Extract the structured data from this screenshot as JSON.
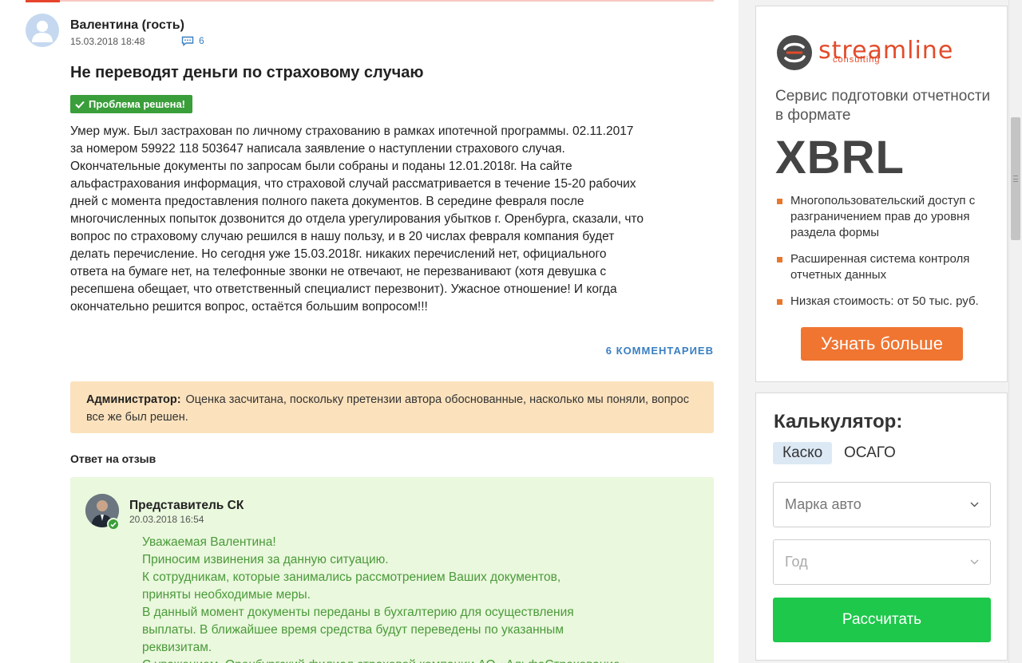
{
  "review": {
    "author": "Валентина (гость)",
    "date": "15.03.2018 18:48",
    "comments_count": "6",
    "title": "Не переводят деньги по страховому случаю",
    "status_badge": "Проблема решена!",
    "body_lines": [
      "Умер муж. Был застрахован по личному страхованию в рамках ипотечной программы. 02.11.2017",
      "за номером 59922 118 503647 написала заявление о наступлении страхового случая.",
      "Окончательные документы по запросам были собраны и поданы 12.01.2018г. На сайте",
      "альфастрахования информация, что страховой случай рассматривается в течение 15-20 рабочих",
      "дней с момента предоставления полного пакета документов. В середине февраля после",
      "многочисленных попыток дозвонится до отдела урегулирования убытков г. Оренбурга, сказали, что",
      "вопрос по страховому случаю решился в нашу пользу, и в 20 числах февраля компания будет",
      "делать перечисление. Но сегодня уже 15.03.2018г. никаких перечислений нет, официального",
      "ответа на бумаге нет, на телефонные звонки не отвечают, не перезванивают (хотя девушка с",
      "ресепшена обещает, что ответственный специалист перезвонит). Ужасное отношение! И когда",
      "окончательно решится вопрос, остаётся большим вопросом!!!"
    ],
    "comments_link": "6 КОММЕНТАРИЕВ"
  },
  "admin_note": {
    "label": "Администратор:",
    "text": "Оценка засчитана, поскольку претензии автора обоснованные, насколько мы поняли, вопрос все же был решен."
  },
  "reply": {
    "heading": "Ответ на отзыв",
    "author": "Представитель СК",
    "date": "20.03.2018 16:54",
    "lines": [
      "Уважаемая Валентина!",
      "Приносим извинения за данную ситуацию.",
      "К сотрудникам, которые занимались рассмотрением Ваших документов,",
      "приняты необходимые меры.",
      "В данный момент документы переданы в бухгалтерию для осуществления",
      "выплаты. В ближайшее время средства будут переведены по указанным",
      "реквизитам.",
      "С уважением, Оренбургский филиал страховой компании АО «АльфаСтрахование»"
    ]
  },
  "ad": {
    "brand": "streamline",
    "brand_sub": "consulting",
    "tagline": "Сервис подготовки отчетности в формате",
    "big_text": "XBRL",
    "features": [
      "Многопользовательский доступ с разграничением прав до уровня раздела формы",
      "Расширенная система контроля отчетных данных",
      "Низкая стоимость: от 50 тыс. руб."
    ],
    "cta": "Узнать больше"
  },
  "calculator": {
    "title": "Калькулятор:",
    "tabs": [
      "Каско",
      "ОСАГО"
    ],
    "brand_placeholder": "Марка авто",
    "year_placeholder": "Год",
    "submit": "Рассчитать"
  },
  "colors": {
    "accent_red": "#e6452b",
    "badge_green": "#3a9e3a",
    "link_blue": "#3a7fc1",
    "admin_bg": "#fbe2bd",
    "reply_bg": "#eaf8dd",
    "reply_text": "#4a9a3a",
    "ad_orange": "#f07531",
    "calc_green": "#1ec84b"
  }
}
